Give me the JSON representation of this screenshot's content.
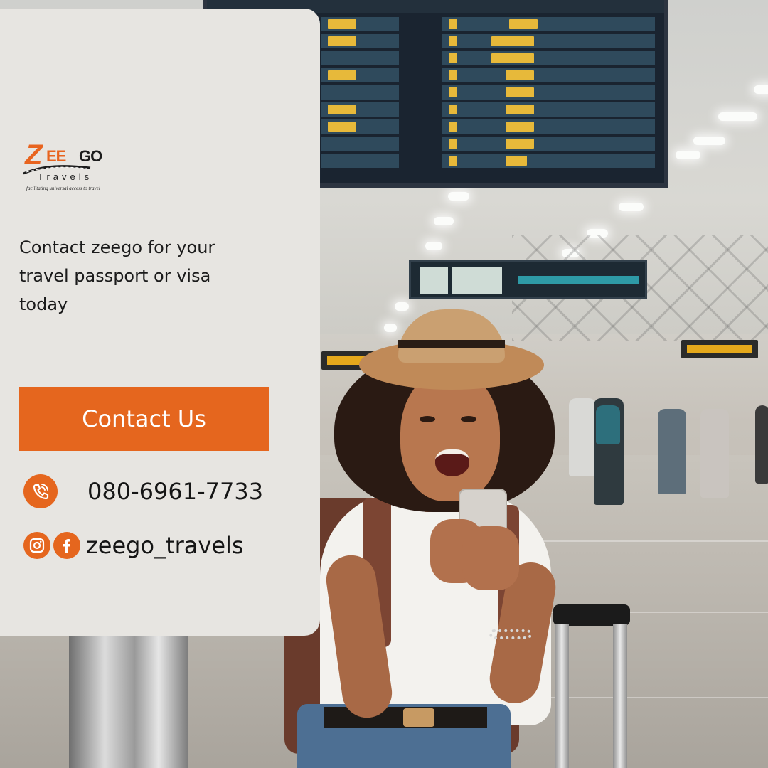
{
  "brand": {
    "logo_letter": "Z",
    "logo_mid": "EE",
    "logo_end": "GO",
    "logo_sub": "Travels",
    "tagline": "facilitating universal access to travel",
    "accent_color": "#e5661e"
  },
  "headline": "Contact zeego for your travel passport or visa today",
  "cta": {
    "label": "Contact Us"
  },
  "contacts": {
    "phone": {
      "icon": "phone-icon",
      "value": "080-6961-7733"
    },
    "social": {
      "icons": [
        "instagram-icon",
        "facebook-icon"
      ],
      "value": "zeego_travels"
    }
  }
}
